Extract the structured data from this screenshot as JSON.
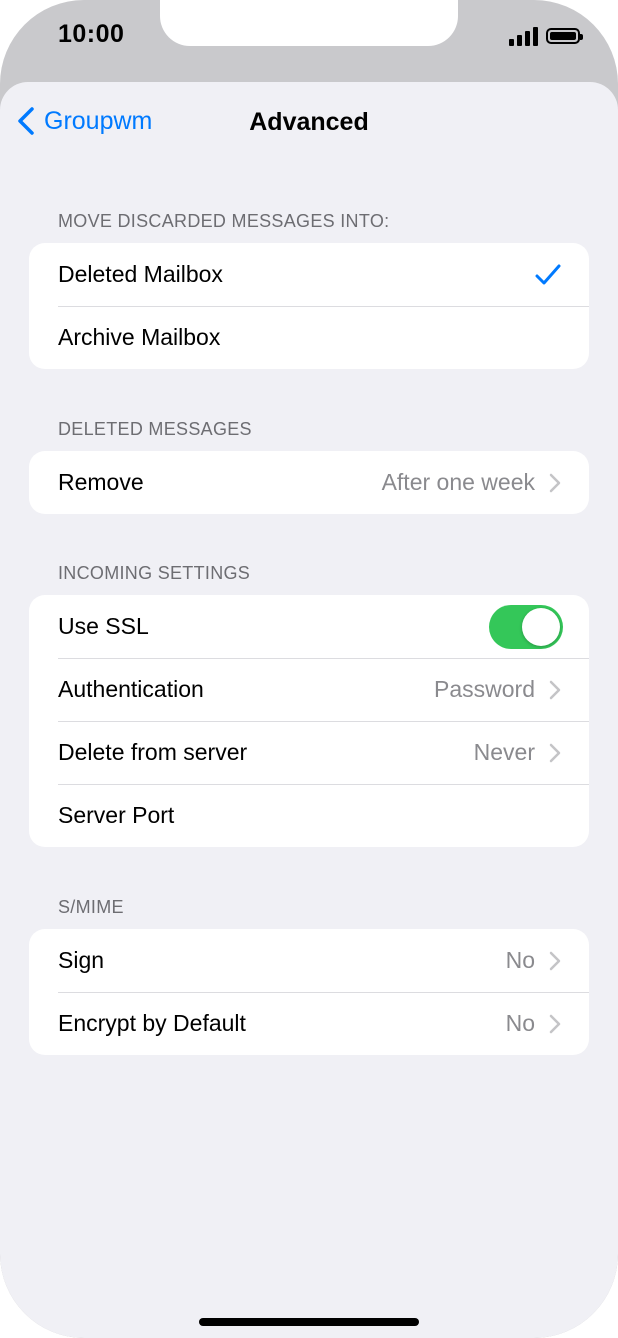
{
  "status_bar": {
    "time": "10:00",
    "signal_icon": "cellular-signal-icon",
    "battery_icon": "battery-full-icon"
  },
  "nav": {
    "back_label": "Groupwm",
    "title": "Advanced"
  },
  "sections": {
    "discarded": {
      "header": "MOVE DISCARDED MESSAGES INTO:",
      "rows": [
        {
          "label": "Deleted Mailbox",
          "selected": true
        },
        {
          "label": "Archive Mailbox",
          "selected": false
        }
      ]
    },
    "deleted": {
      "header": "DELETED MESSAGES",
      "remove_label": "Remove",
      "remove_value": "After one week"
    },
    "incoming": {
      "header": "INCOMING SETTINGS",
      "ssl_label": "Use SSL",
      "ssl_on": true,
      "auth_label": "Authentication",
      "auth_value": "Password",
      "delete_label": "Delete from server",
      "delete_value": "Never",
      "port_label": "Server Port"
    },
    "smime": {
      "header": "S/MIME",
      "sign_label": "Sign",
      "sign_value": "No",
      "encrypt_label": "Encrypt by Default",
      "encrypt_value": "No"
    }
  },
  "colors": {
    "accent": "#007aff",
    "toggle_on": "#34c759",
    "background": "#f0f0f5",
    "secondary_text": "#8a8a8e"
  }
}
